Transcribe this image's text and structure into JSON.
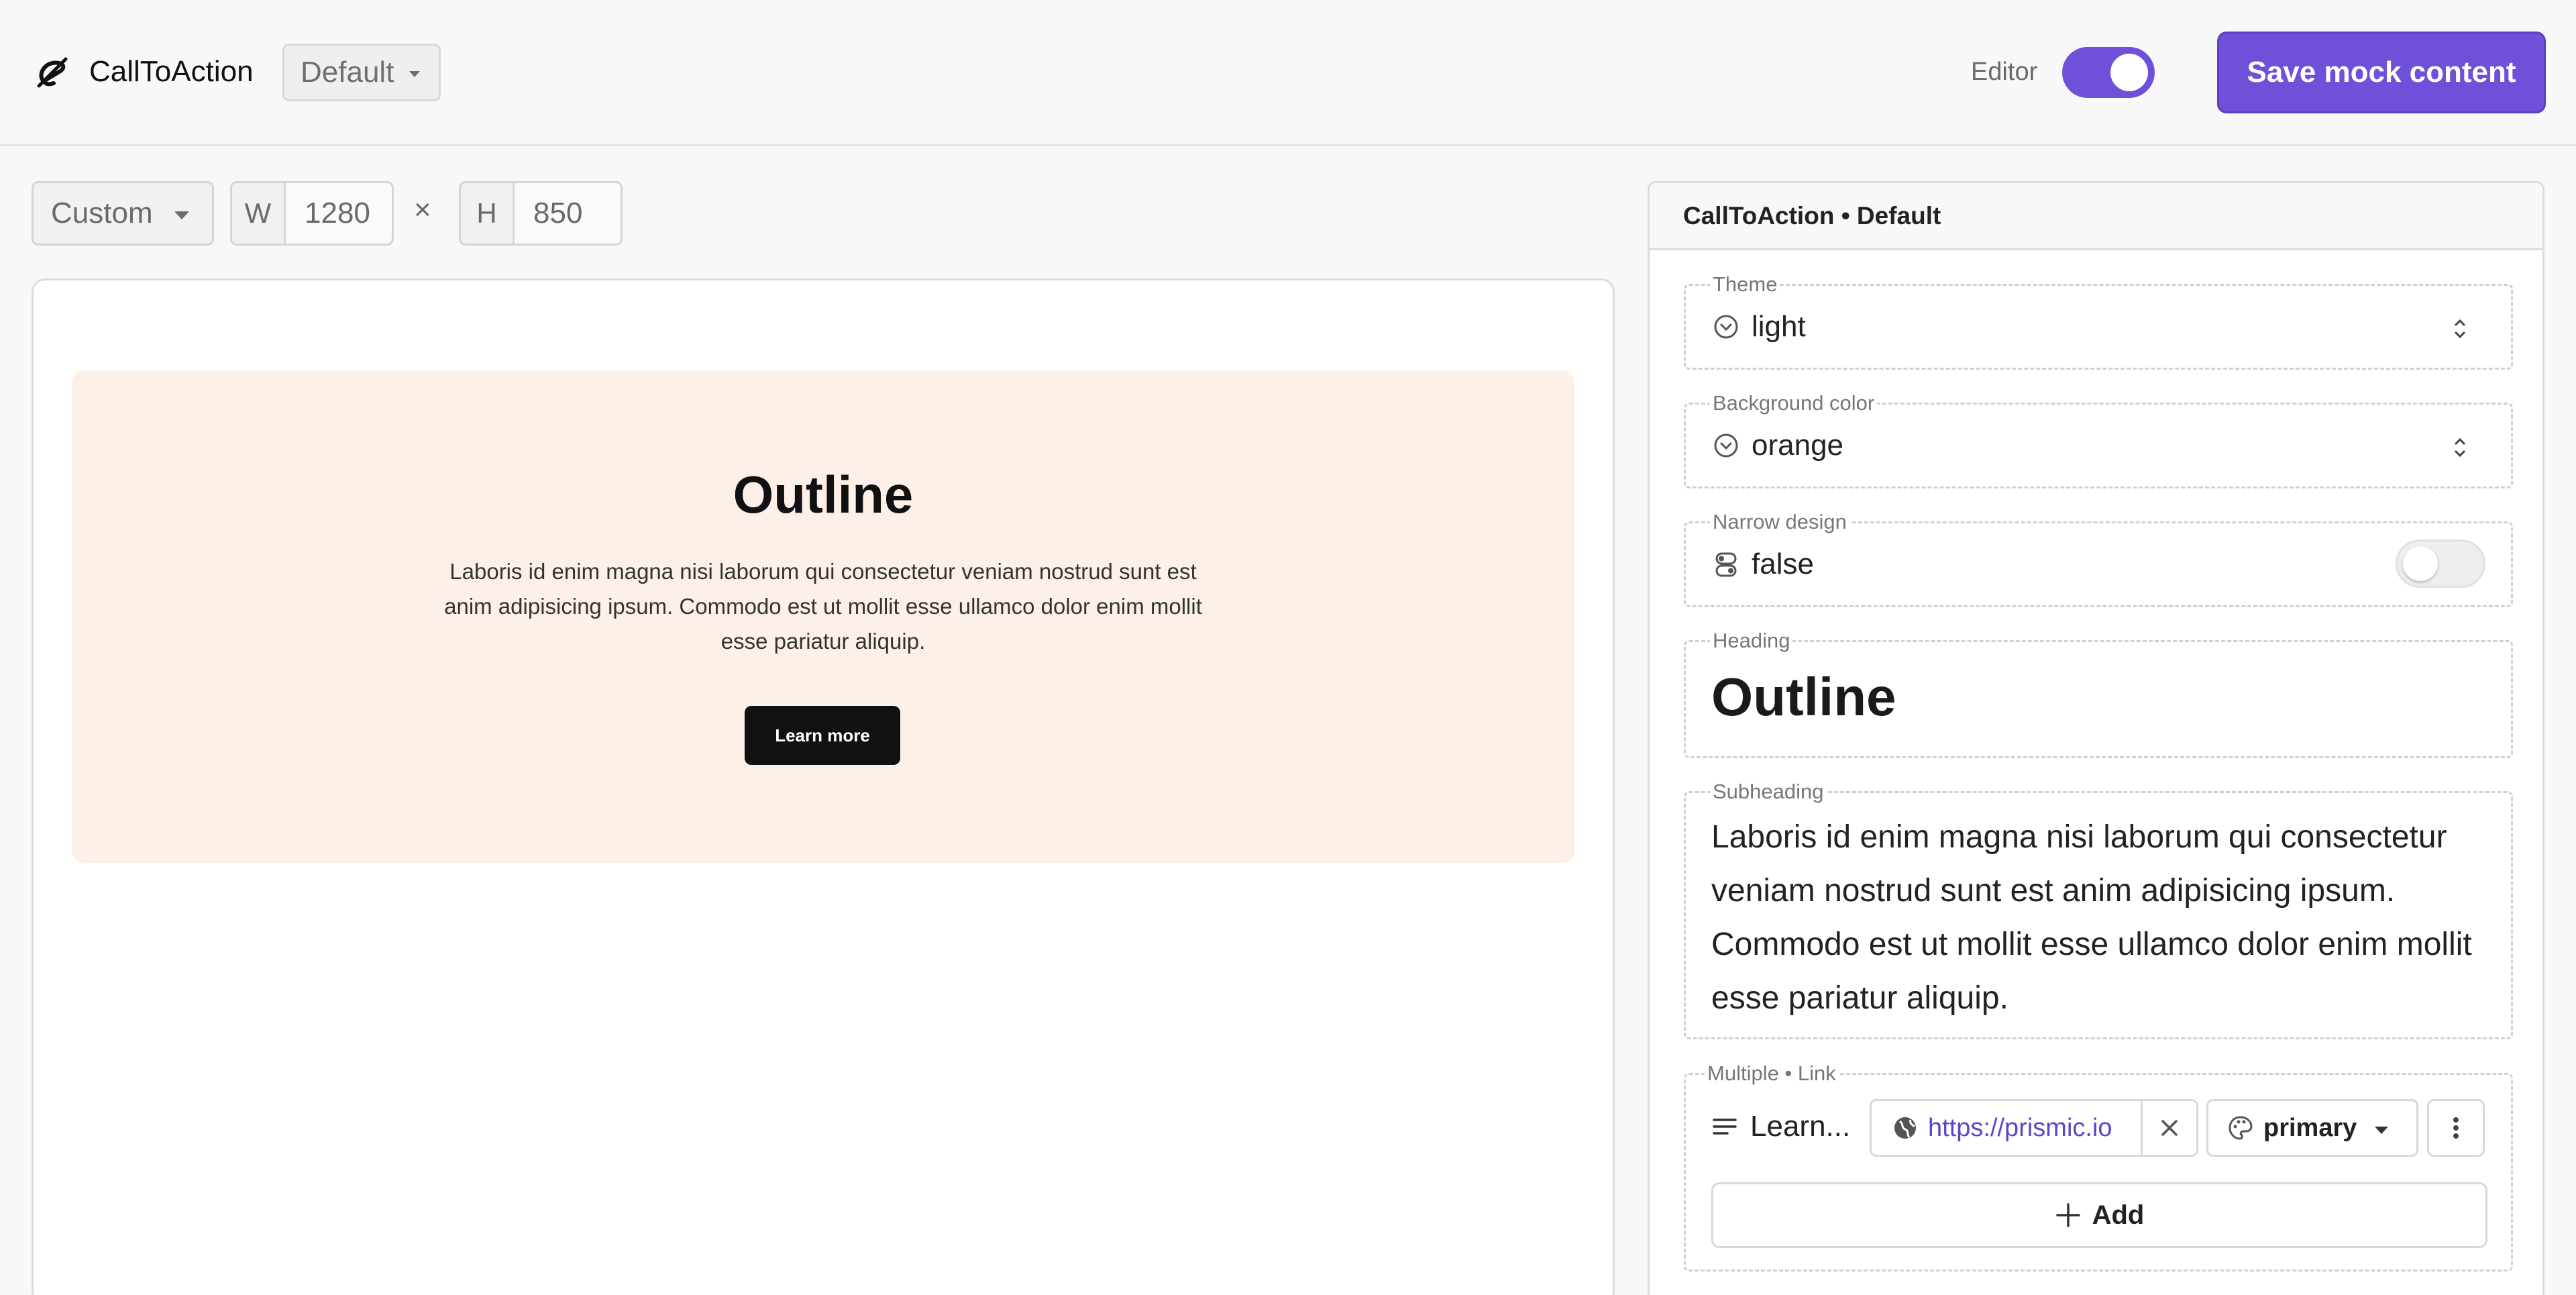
{
  "header": {
    "app_title": "CallToAction",
    "variation": "Default",
    "editor_label": "Editor",
    "editor_enabled": true,
    "save_label": "Save mock content"
  },
  "toolbar": {
    "size_preset": "Custom",
    "width_prefix": "W",
    "width_value": "1280",
    "times": "×",
    "height_prefix": "H",
    "height_value": "850"
  },
  "preview": {
    "heading": "Outline",
    "subheading": "Laboris id enim magna nisi laborum qui consectetur veniam nostrud sunt est anim adipisicing ipsum. Commodo est ut mollit esse ullamco dolor enim mollit esse pariatur aliquip.",
    "button_label": "Learn more",
    "background_color": "#fdf0e8"
  },
  "panel": {
    "title": "CallToAction • Default",
    "fields": {
      "theme": {
        "label": "Theme",
        "value": "light"
      },
      "background_color": {
        "label": "Background color",
        "value": "orange"
      },
      "narrow_design": {
        "label": "Narrow design",
        "value": "false",
        "enabled": false
      },
      "heading": {
        "label": "Heading",
        "value": "Outline"
      },
      "subheading": {
        "label": "Subheading",
        "value": "Laboris id enim magna nisi laborum qui consectetur veniam nostrud sunt est anim adipisicing ipsum. Commodo est ut mollit esse ullamco dolor enim mollit esse pariatur aliquip."
      },
      "links": {
        "label": "Multiple • Link",
        "items": [
          {
            "text": "Learn...",
            "url": "https://prismic.io",
            "variant": "primary"
          }
        ],
        "add_label": "Add"
      }
    }
  },
  "colors": {
    "accent": "#6e50d9",
    "link": "#5b46c9",
    "cta_background": "#fdf0e8"
  }
}
